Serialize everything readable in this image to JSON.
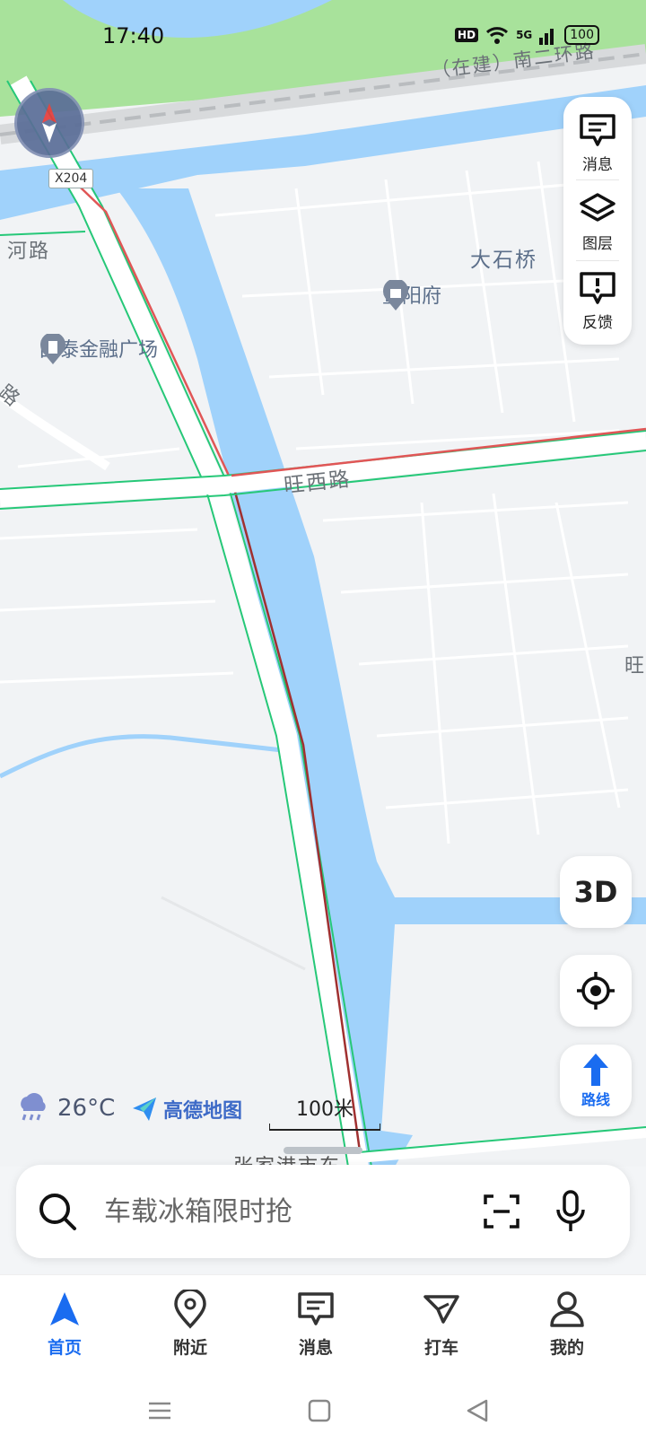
{
  "status_bar": {
    "time": "17:40",
    "hd": "HD",
    "network": "5G",
    "battery": "100"
  },
  "map": {
    "road_tag": "X204",
    "labels": {
      "road_top": "（在建）南二环路",
      "road_left": "河路",
      "road_left2": "路",
      "road_wangxi": "旺西路",
      "edge_right": "旺",
      "area_bottom": "张家港市东"
    },
    "pois": {
      "dashiqiao": "大石桥",
      "jiyangfu": "暨阳府",
      "guotai": "国泰金融广场"
    }
  },
  "right_panel": {
    "messages": "消息",
    "layers": "图层",
    "feedback": "反馈"
  },
  "controls": {
    "three_d": "3D",
    "route": "路线"
  },
  "weather": {
    "temperature": "26°C",
    "icon": "rain-cloud-icon"
  },
  "brand": {
    "name": "高德地图"
  },
  "scale": {
    "label": "100米"
  },
  "search": {
    "placeholder": "车载冰箱限时抢"
  },
  "bottom_nav": [
    {
      "label": "首页",
      "icon": "navigation-arrow-icon",
      "active": true
    },
    {
      "label": "附近",
      "icon": "location-pin-icon",
      "active": false
    },
    {
      "label": "消息",
      "icon": "message-icon",
      "active": false
    },
    {
      "label": "打车",
      "icon": "taxi-icon",
      "active": false
    },
    {
      "label": "我的",
      "icon": "user-icon",
      "active": false
    }
  ],
  "colors": {
    "accent": "#1a6cf0",
    "water": "#a0d2fb",
    "park": "#a8e29b",
    "road_red": "#e05656",
    "road_green": "#26c878"
  }
}
